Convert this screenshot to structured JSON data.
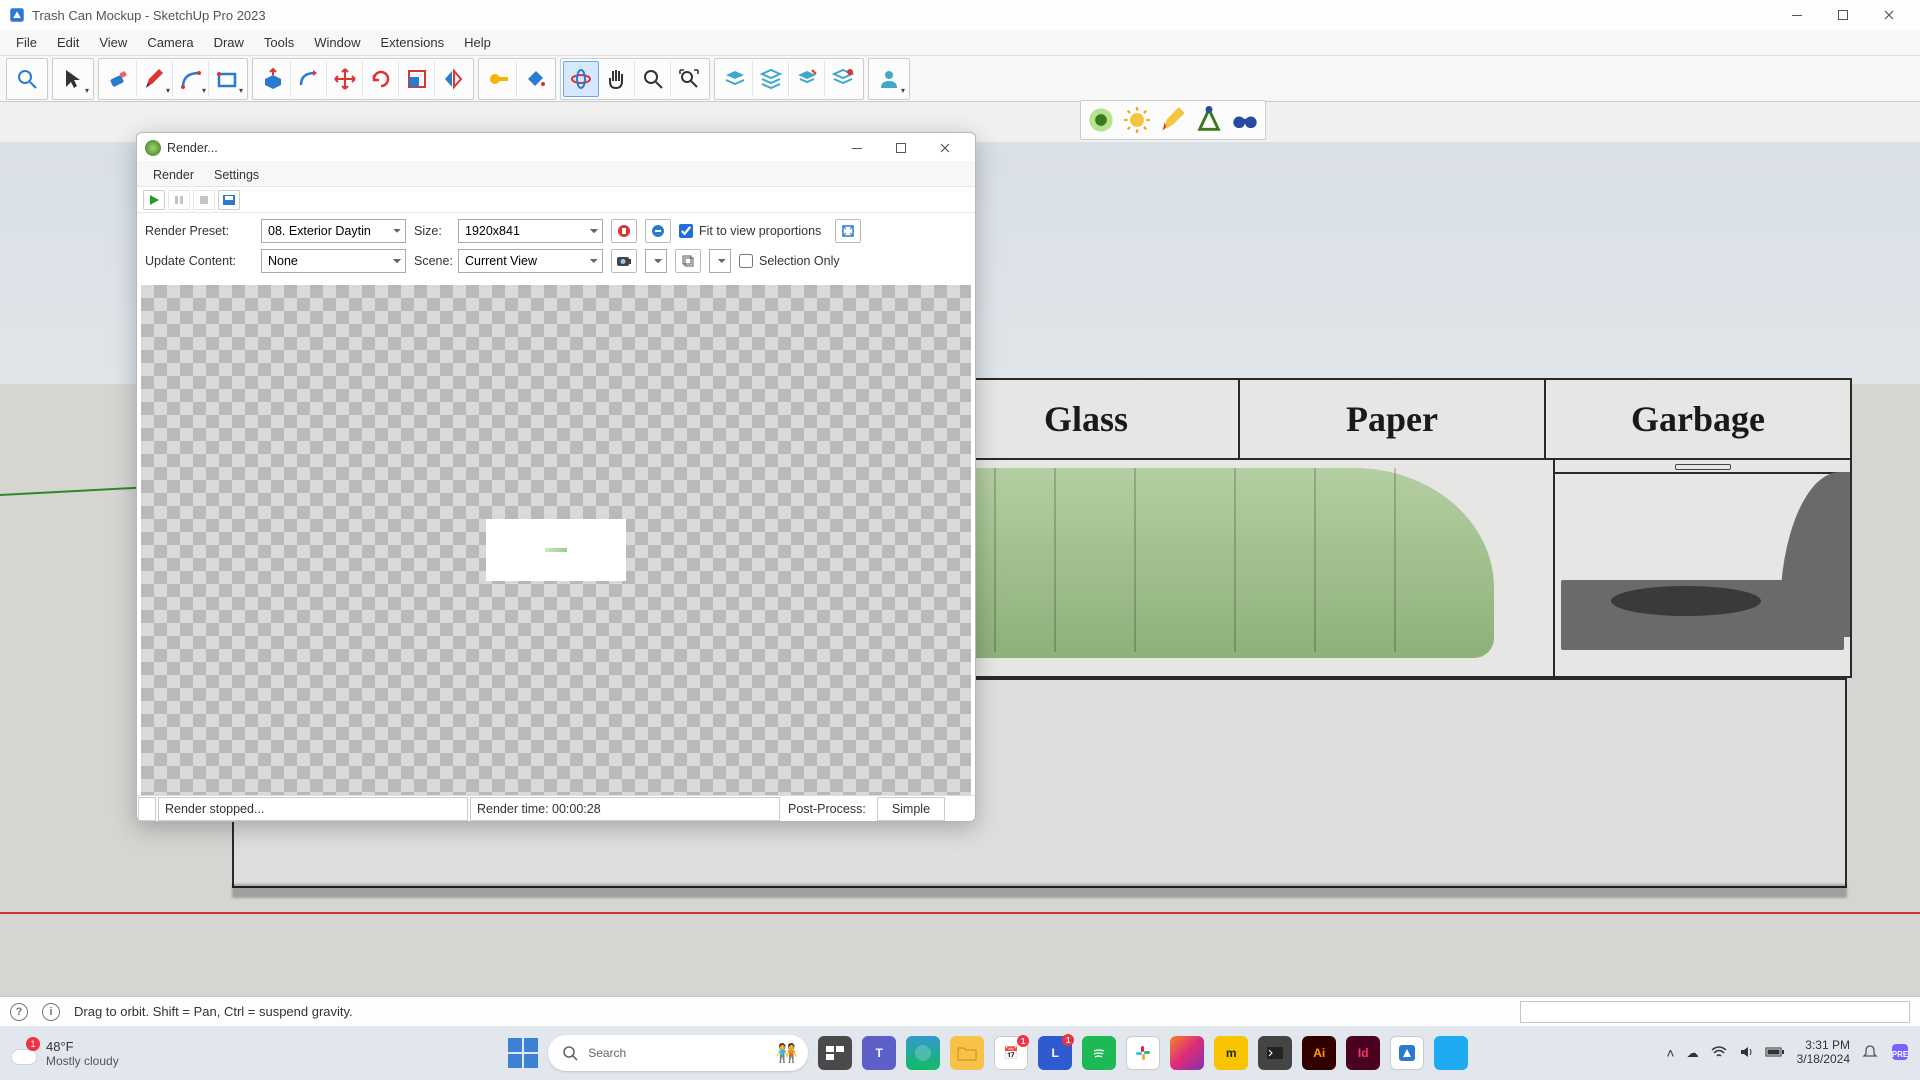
{
  "app": {
    "title": "Trash Can Mockup - SketchUp Pro 2023"
  },
  "menu": [
    "File",
    "Edit",
    "View",
    "Camera",
    "Draw",
    "Tools",
    "Window",
    "Extensions",
    "Help"
  ],
  "toolbar_icons": [
    "search",
    "select",
    "eraser",
    "pencil",
    "arc",
    "rectangle",
    "push-pull",
    "follow-me",
    "move",
    "rotate",
    "scale",
    "flip",
    "tape-measure",
    "dimension",
    "section",
    "walk",
    "orbit",
    "zoom",
    "zoom-extents",
    "layers",
    "outliner",
    "materials",
    "scenes",
    "profile"
  ],
  "extra_toolbar": [
    "render-start",
    "sun",
    "pencil-tool",
    "vertex",
    "binoculars"
  ],
  "render_dialog": {
    "title": "Render...",
    "menu": [
      "Render",
      "Settings"
    ],
    "render_preset_label": "Render Preset:",
    "render_preset_value": "08. Exterior Daytin",
    "size_label": "Size:",
    "size_value": "1920x841",
    "fit_label": "Fit to view proportions",
    "fit_checked": true,
    "update_label": "Update Content:",
    "update_value": "None",
    "scene_label": "Scene:",
    "scene_value": "Current View",
    "selection_only_label": "Selection Only",
    "selection_only_checked": false,
    "status_left": "Render stopped...",
    "status_time": "Render time: 00:00:28",
    "post_process_label": "Post-Process:",
    "post_process_value": "Simple"
  },
  "model_labels": [
    "Glass",
    "Paper",
    "Garbage"
  ],
  "status_hint": "Drag to orbit. Shift = Pan, Ctrl = suspend gravity.",
  "taskbar": {
    "weather_temp": "48°F",
    "weather_desc": "Mostly cloudy",
    "weather_badge": "1",
    "search_placeholder": "Search",
    "time": "3:31 PM",
    "date": "3/18/2024"
  }
}
